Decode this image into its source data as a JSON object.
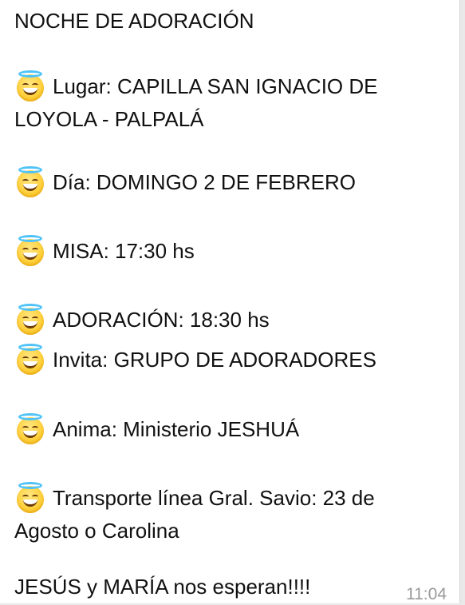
{
  "message": {
    "title": "NOCHE DE ADORACIÓN",
    "lugar_line1": "Lugar: CAPILLA SAN IGNACIO DE",
    "lugar_line2": "LOYOLA - PALPALÁ",
    "dia": "Día: DOMINGO 2 DE  FEBRERO",
    "misa": "MISA: 17:30 hs",
    "adoracion": "ADORACIÓN: 18:30 hs",
    "invita": "Invita:  GRUPO DE ADORADORES",
    "anima": "Anima: Ministerio JESHUÁ",
    "transporte_line1": "Transporte línea Gral. Savio: 23 de",
    "transporte_line2": "Agosto o Carolina",
    "closing": "JESÚS y MARÍA nos esperan!!!!",
    "time": "11:04",
    "emoji_icon": "smiling-face-with-halo-icon"
  }
}
